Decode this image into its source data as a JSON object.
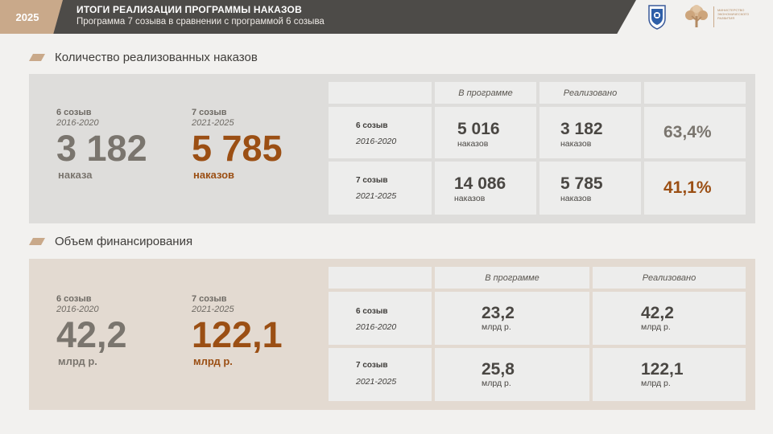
{
  "header": {
    "year": "2025",
    "title": "ИТОГИ РЕАЛИЗАЦИИ ПРОГРАММЫ НАКАЗОВ",
    "subtitle": "Программа 7 созыва в сравнении с программой 6 созыва",
    "ministry_text": "МИНИСТЕРСТВО ЭКОНОМИЧЕСКОГО РАЗВИТИЯ"
  },
  "colors": {
    "accent": "#c9a98a",
    "orange": "#9b4f14",
    "gray": "#7a756e",
    "header_bg": "#4d4b48"
  },
  "section1": {
    "title": "Количество реализованных наказов",
    "left": {
      "s6_label": "6 созыв",
      "s6_years": "2016-2020",
      "s6_value": "3 182",
      "s6_unit": "наказа",
      "s7_label": "7 созыв",
      "s7_years": "2021-2025",
      "s7_value": "5 785",
      "s7_unit": "наказов"
    },
    "table": {
      "headers": [
        "В программе",
        "Реализовано"
      ],
      "rows": [
        {
          "label": "6 созыв",
          "years": "2016-2020",
          "program": "5 016",
          "program_unit": "наказов",
          "done": "3 182",
          "done_unit": "наказов",
          "pct": "63,4%"
        },
        {
          "label": "7 созыв",
          "years": "2021-2025",
          "program": "14 086",
          "program_unit": "наказов",
          "done": "5 785",
          "done_unit": "наказов",
          "pct": "41,1%"
        }
      ]
    }
  },
  "section2": {
    "title": "Объем финансирования",
    "left": {
      "s6_label": "6 созыв",
      "s6_years": "2016-2020",
      "s6_value": "42,2",
      "s6_unit": "млрд р.",
      "s7_label": "7 созыв",
      "s7_years": "2021-2025",
      "s7_value": "122,1",
      "s7_unit": "млрд р."
    },
    "table": {
      "headers": [
        "В программе",
        "Реализовано"
      ],
      "rows": [
        {
          "label": "6 созыв",
          "years": "2016-2020",
          "program": "23,2",
          "program_unit": "млрд р.",
          "done": "42,2",
          "done_unit": "млрд р."
        },
        {
          "label": "7 созыв",
          "years": "2021-2025",
          "program": "25,8",
          "program_unit": "млрд р.",
          "done": "122,1",
          "done_unit": "млрд р."
        }
      ]
    }
  }
}
